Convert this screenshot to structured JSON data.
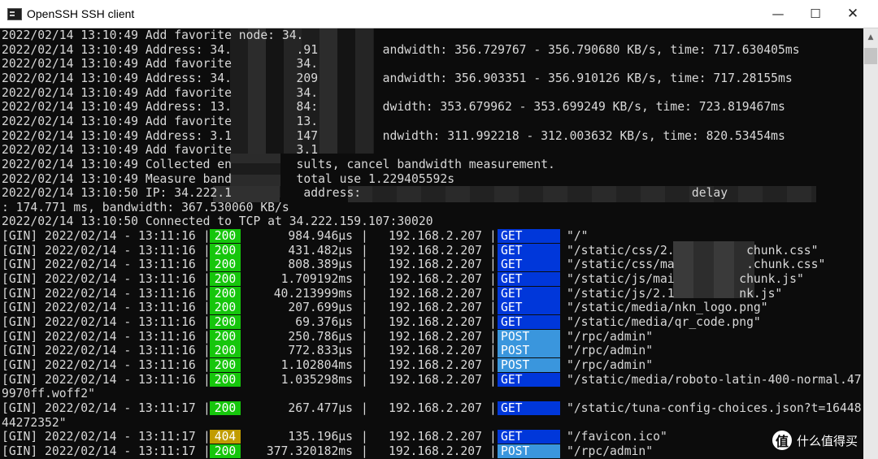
{
  "window": {
    "title": "OpenSSH SSH client",
    "minimize": "—",
    "maximize": "☐",
    "close": "✕"
  },
  "log_lines": [
    "2022/02/14 13:10:49 Add favorite node: 34.",
    "2022/02/14 13:10:49 Address: 34.         .91         andwidth: 356.729767 - 356.790680 KB/s, time: 717.630405ms",
    "2022/02/14 13:10:49 Add favorite         34.",
    "2022/02/14 13:10:49 Address: 34.         209         andwidth: 356.903351 - 356.910126 KB/s, time: 717.28155ms",
    "2022/02/14 13:10:49 Add favorite         34.",
    "2022/02/14 13:10:49 Address: 13.         84:         dwidth: 353.679962 - 353.699249 KB/s, time: 723.819467ms",
    "2022/02/14 13:10:49 Add favorite         13.",
    "2022/02/14 13:10:49 Address: 3.1         147         ndwidth: 311.992218 - 312.003632 KB/s, time: 820.53454ms",
    "2022/02/14 13:10:49 Add favorite         3.1",
    "2022/02/14 13:10:49 Collected en         sults, cancel bandwidth measurement.",
    "2022/02/14 13:10:49 Measure band         total use 1.229405592s",
    "2022/02/14 13:10:50 IP: 34.222.1          address:                                              delay",
    ": 174.771 ms, bandwidth: 367.530060 KB/s",
    "2022/02/14 13:10:50 Connected to TCP at 34.222.159.107:30020"
  ],
  "gin_requests": [
    {
      "prefix": "[GIN] 2022/02/14 - 13:11:16",
      "status": "200",
      "latency": "984.946µs",
      "ip": "192.168.2.207",
      "method": "GET",
      "path": "\"/\""
    },
    {
      "prefix": "[GIN] 2022/02/14 - 13:11:16",
      "status": "200",
      "latency": "431.482µs",
      "ip": "192.168.2.207",
      "method": "GET",
      "path": "\"/static/css/2.          chunk.css\""
    },
    {
      "prefix": "[GIN] 2022/02/14 - 13:11:16",
      "status": "200",
      "latency": "808.389µs",
      "ip": "192.168.2.207",
      "method": "GET",
      "path": "\"/static/css/ma          .chunk.css\""
    },
    {
      "prefix": "[GIN] 2022/02/14 - 13:11:16",
      "status": "200",
      "latency": "1.709192ms",
      "ip": "192.168.2.207",
      "method": "GET",
      "path": "\"/static/js/mai         chunk.js\""
    },
    {
      "prefix": "[GIN] 2022/02/14 - 13:11:16",
      "status": "200",
      "latency": "40.213999ms",
      "ip": "192.168.2.207",
      "method": "GET",
      "path": "\"/static/js/2.1         nk.js\""
    },
    {
      "prefix": "[GIN] 2022/02/14 - 13:11:16",
      "status": "200",
      "latency": "207.699µs",
      "ip": "192.168.2.207",
      "method": "GET",
      "path": "\"/static/media/nkn_logo.png\""
    },
    {
      "prefix": "[GIN] 2022/02/14 - 13:11:16",
      "status": "200",
      "latency": "69.376µs",
      "ip": "192.168.2.207",
      "method": "GET",
      "path": "\"/static/media/qr_code.png\""
    },
    {
      "prefix": "[GIN] 2022/02/14 - 13:11:16",
      "status": "200",
      "latency": "250.786µs",
      "ip": "192.168.2.207",
      "method": "POST",
      "path": "\"/rpc/admin\""
    },
    {
      "prefix": "[GIN] 2022/02/14 - 13:11:16",
      "status": "200",
      "latency": "772.833µs",
      "ip": "192.168.2.207",
      "method": "POST",
      "path": "\"/rpc/admin\""
    },
    {
      "prefix": "[GIN] 2022/02/14 - 13:11:16",
      "status": "200",
      "latency": "1.102804ms",
      "ip": "192.168.2.207",
      "method": "POST",
      "path": "\"/rpc/admin\""
    },
    {
      "prefix": "[GIN] 2022/02/14 - 13:11:16",
      "status": "200",
      "latency": "1.035298ms",
      "ip": "192.168.2.207",
      "method": "GET",
      "path": "\"/static/media/roboto-latin-400-normal.47"
    },
    {
      "prefix": "[GIN] 2022/02/14 - 13:11:17",
      "status": "200",
      "latency": "267.477µs",
      "ip": "192.168.2.207",
      "method": "GET",
      "path": "\"/static/tuna-config-choices.json?t=16448"
    },
    {
      "prefix": "[GIN] 2022/02/14 - 13:11:17",
      "status": "404",
      "latency": "135.196µs",
      "ip": "192.168.2.207",
      "method": "GET",
      "path": "\"/favicon.ico\""
    },
    {
      "prefix": "[GIN] 2022/02/14 - 13:11:17",
      "status": "200",
      "latency": "377.320182ms",
      "ip": "192.168.2.207",
      "method": "POST",
      "path": "\"/rpc/admin\""
    }
  ],
  "wrapped": {
    "roboto_cont": "9970ff.woff2\"",
    "tuna_cont": "44272352\""
  },
  "pipe_char": "|",
  "watermark": {
    "logo_char": "值",
    "text": "什么值得买"
  },
  "colors": {
    "status_ok": "#16c60c",
    "status_warn": "#c19c00",
    "method_get": "#0037da",
    "method_post": "#3a96dd",
    "console_bg": "#0c0c0c",
    "console_fg": "#d8d8d8"
  }
}
